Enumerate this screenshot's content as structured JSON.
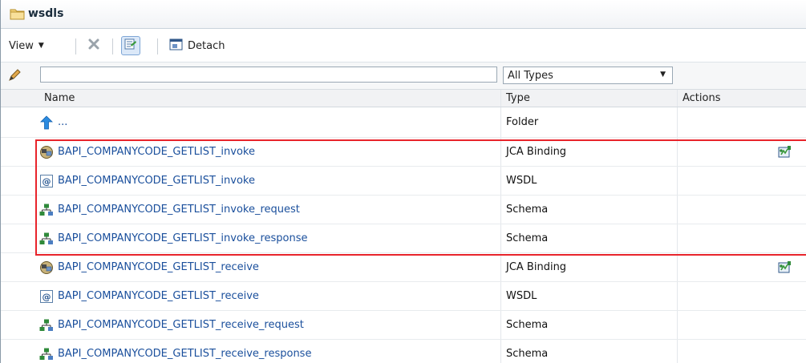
{
  "window": {
    "title": "wsdls"
  },
  "toolbar": {
    "view_label": "View",
    "detach_label": "Detach"
  },
  "filter": {
    "name_value": "",
    "type_selected": "All Types"
  },
  "table": {
    "columns": {
      "name": "Name",
      "type": "Type",
      "actions": "Actions"
    },
    "parent_row": {
      "name": "...",
      "type": "Folder"
    },
    "rows": [
      {
        "name": "BAPI_COMPANYCODE_GETLIST_invoke",
        "type": "JCA Binding",
        "icon": "jca-binding-icon",
        "has_action": true
      },
      {
        "name": "BAPI_COMPANYCODE_GETLIST_invoke",
        "type": "WSDL",
        "icon": "wsdl-icon",
        "has_action": false
      },
      {
        "name": "BAPI_COMPANYCODE_GETLIST_invoke_request",
        "type": "Schema",
        "icon": "schema-icon",
        "has_action": false
      },
      {
        "name": "BAPI_COMPANYCODE_GETLIST_invoke_response",
        "type": "Schema",
        "icon": "schema-icon",
        "has_action": false
      },
      {
        "name": "BAPI_COMPANYCODE_GETLIST_receive",
        "type": "JCA Binding",
        "icon": "jca-binding-icon",
        "has_action": true
      },
      {
        "name": "BAPI_COMPANYCODE_GETLIST_receive",
        "type": "WSDL",
        "icon": "wsdl-icon",
        "has_action": false
      },
      {
        "name": "BAPI_COMPANYCODE_GETLIST_receive_request",
        "type": "Schema",
        "icon": "schema-icon",
        "has_action": false
      },
      {
        "name": "BAPI_COMPANYCODE_GETLIST_receive_response",
        "type": "Schema",
        "icon": "schema-icon",
        "has_action": false
      }
    ]
  },
  "colors": {
    "link": "#1a4f9c",
    "highlight": "#e8242b"
  }
}
